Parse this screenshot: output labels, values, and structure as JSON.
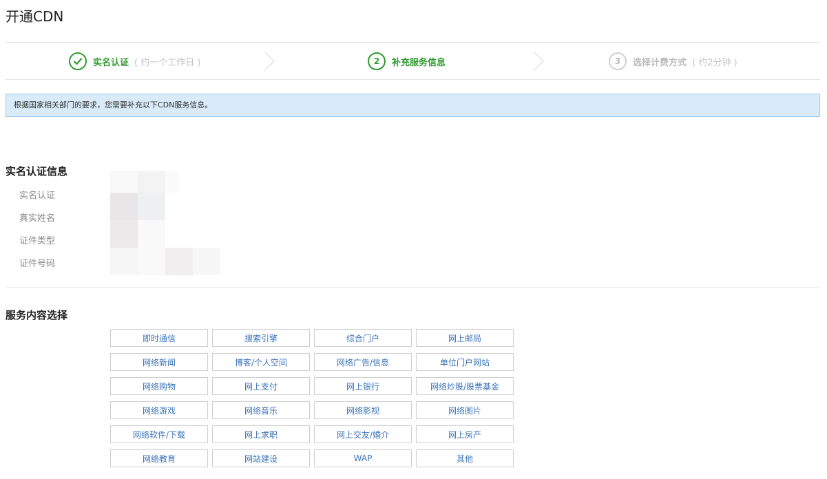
{
  "page": {
    "title": "开通CDN"
  },
  "steps": [
    {
      "number": "1",
      "label": "实名认证",
      "note": "( 约一个工作日 )",
      "state": "done",
      "icon": "check-icon"
    },
    {
      "number": "2",
      "label": "补充服务信息",
      "note": "",
      "state": "active"
    },
    {
      "number": "3",
      "label": "选择计费方式",
      "note": "( 约2分钟 )",
      "state": "pending"
    }
  ],
  "notice": {
    "text": "根据国家相关部门的要求，您需要补充以下CDN服务信息。"
  },
  "identity": {
    "heading": "实名认证信息",
    "fields": [
      {
        "label": "实名认证"
      },
      {
        "label": "真实姓名"
      },
      {
        "label": "证件类型"
      },
      {
        "label": "证件号码"
      }
    ]
  },
  "services": {
    "heading": "服务内容选择",
    "options": [
      "即时通信",
      "搜索引擎",
      "综合门户",
      "网上邮局",
      "网络新闻",
      "博客/个人空间",
      "网络广告/信息",
      "单位门户网站",
      "网络购物",
      "网上支付",
      "网上银行",
      "网络炒股/股票基金",
      "网络游戏",
      "网络音乐",
      "网络影视",
      "网络图片",
      "网络软件/下载",
      "网上求职",
      "网上交友/婚介",
      "网上房产",
      "网络教育",
      "网站建设",
      "WAP",
      "其他"
    ]
  },
  "colors": {
    "accent_green": "#2e9b2e",
    "notice_bg": "#d9ebf8",
    "link_blue": "#3b73b9"
  }
}
